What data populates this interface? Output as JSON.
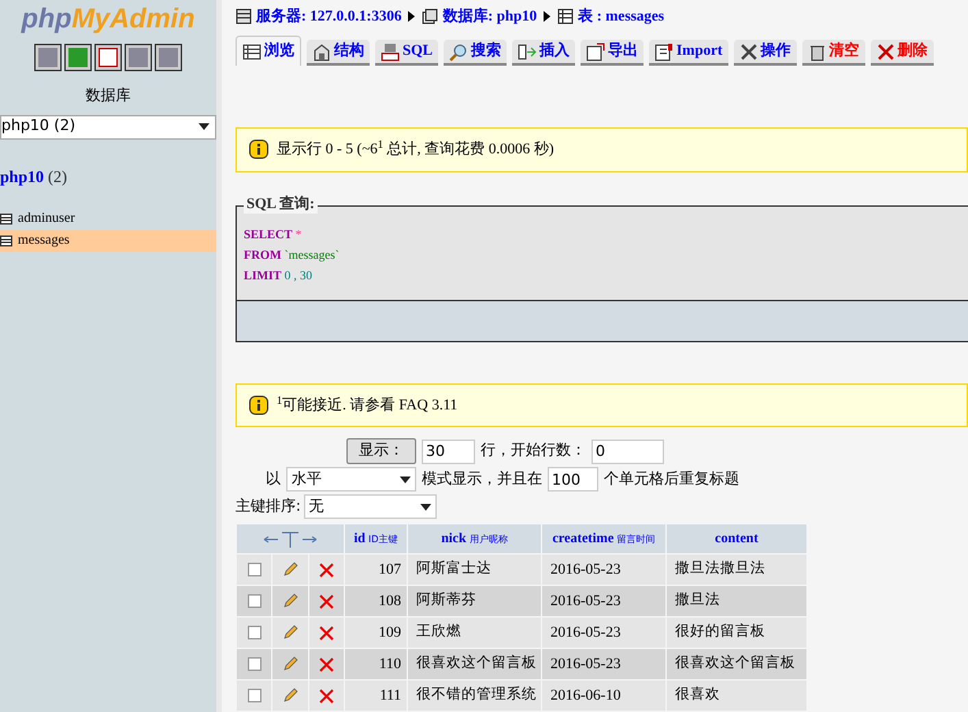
{
  "logo": {
    "part1": "php",
    "part2": "MyAdmin"
  },
  "sidebar": {
    "label": "数据库",
    "db_select": "php10 (2)",
    "db_link": {
      "name": "php10",
      "count": "(2)"
    },
    "tables": [
      {
        "name": "adminuser",
        "selected": false
      },
      {
        "name": "messages",
        "selected": true
      }
    ]
  },
  "breadcrumb": [
    {
      "label": "服务器: 127.0.0.1:3306"
    },
    {
      "label": "数据库: php10"
    },
    {
      "label": "表 : messages"
    }
  ],
  "tabs": [
    {
      "label": "浏览",
      "selected": true,
      "danger": false
    },
    {
      "label": "结构",
      "selected": false,
      "danger": false
    },
    {
      "label": "SQL",
      "selected": false,
      "danger": false
    },
    {
      "label": "搜索",
      "selected": false,
      "danger": false
    },
    {
      "label": "插入",
      "selected": false,
      "danger": false
    },
    {
      "label": "导出",
      "selected": false,
      "danger": false
    },
    {
      "label": "Import",
      "selected": false,
      "danger": false
    },
    {
      "label": "操作",
      "selected": false,
      "danger": false
    },
    {
      "label": "清空",
      "selected": false,
      "danger": true
    },
    {
      "label": "删除",
      "selected": false,
      "danger": true
    }
  ],
  "notice": "显示行 0 - 5 (~6$^{1}$ 总计, 查询花费 0.0006 秒)",
  "sql": {
    "legend": "SQL 查询:",
    "lines": [
      {
        "keyword": "SELECT",
        "rest": "*",
        "kind": "star"
      },
      {
        "keyword": "FROM",
        "rest": "`messages`",
        "kind": "table"
      },
      {
        "keyword": "LIMIT",
        "rest": "0 , 30",
        "kind": "number"
      }
    ]
  },
  "notice2": "$^{1}$可能接近. 请参看 FAQ 3.11",
  "controls": {
    "show_button": "显示：",
    "rows_value": "30",
    "rows_text": "行，开始行数：",
    "start_value": "0",
    "mode_prefix": "以",
    "mode_value": "水平",
    "mode_text": "模式显示，并且在",
    "repeat_value": "100",
    "repeat_text": "个单元格后重复标题",
    "sort_label": "主键排序:",
    "sort_value": "无"
  },
  "table": {
    "columns": [
      {
        "name": "id",
        "comment": "ID主键"
      },
      {
        "name": "nick",
        "comment": "用户昵称"
      },
      {
        "name": "createtime",
        "comment": "留言时间"
      },
      {
        "name": "content"
      }
    ],
    "rows": [
      {
        "checked": false,
        "id": "107",
        "nick": "阿斯富士达",
        "createtime": "2016-05-23",
        "content": "撒旦法撒旦法"
      },
      {
        "checked": false,
        "id": "108",
        "nick": "阿斯蒂芬",
        "createtime": "2016-05-23",
        "content": "撒旦法"
      },
      {
        "checked": false,
        "id": "109",
        "nick": "王欣燃",
        "createtime": "2016-05-23",
        "content": "很好的留言板"
      },
      {
        "checked": false,
        "id": "110",
        "nick": "很喜欢这个留言板",
        "createtime": "2016-05-23",
        "content": "很喜欢这个留言板"
      },
      {
        "checked": false,
        "id": "111",
        "nick": "很不错的管理系统",
        "createtime": "2016-06-10",
        "content": "很喜欢"
      }
    ]
  }
}
